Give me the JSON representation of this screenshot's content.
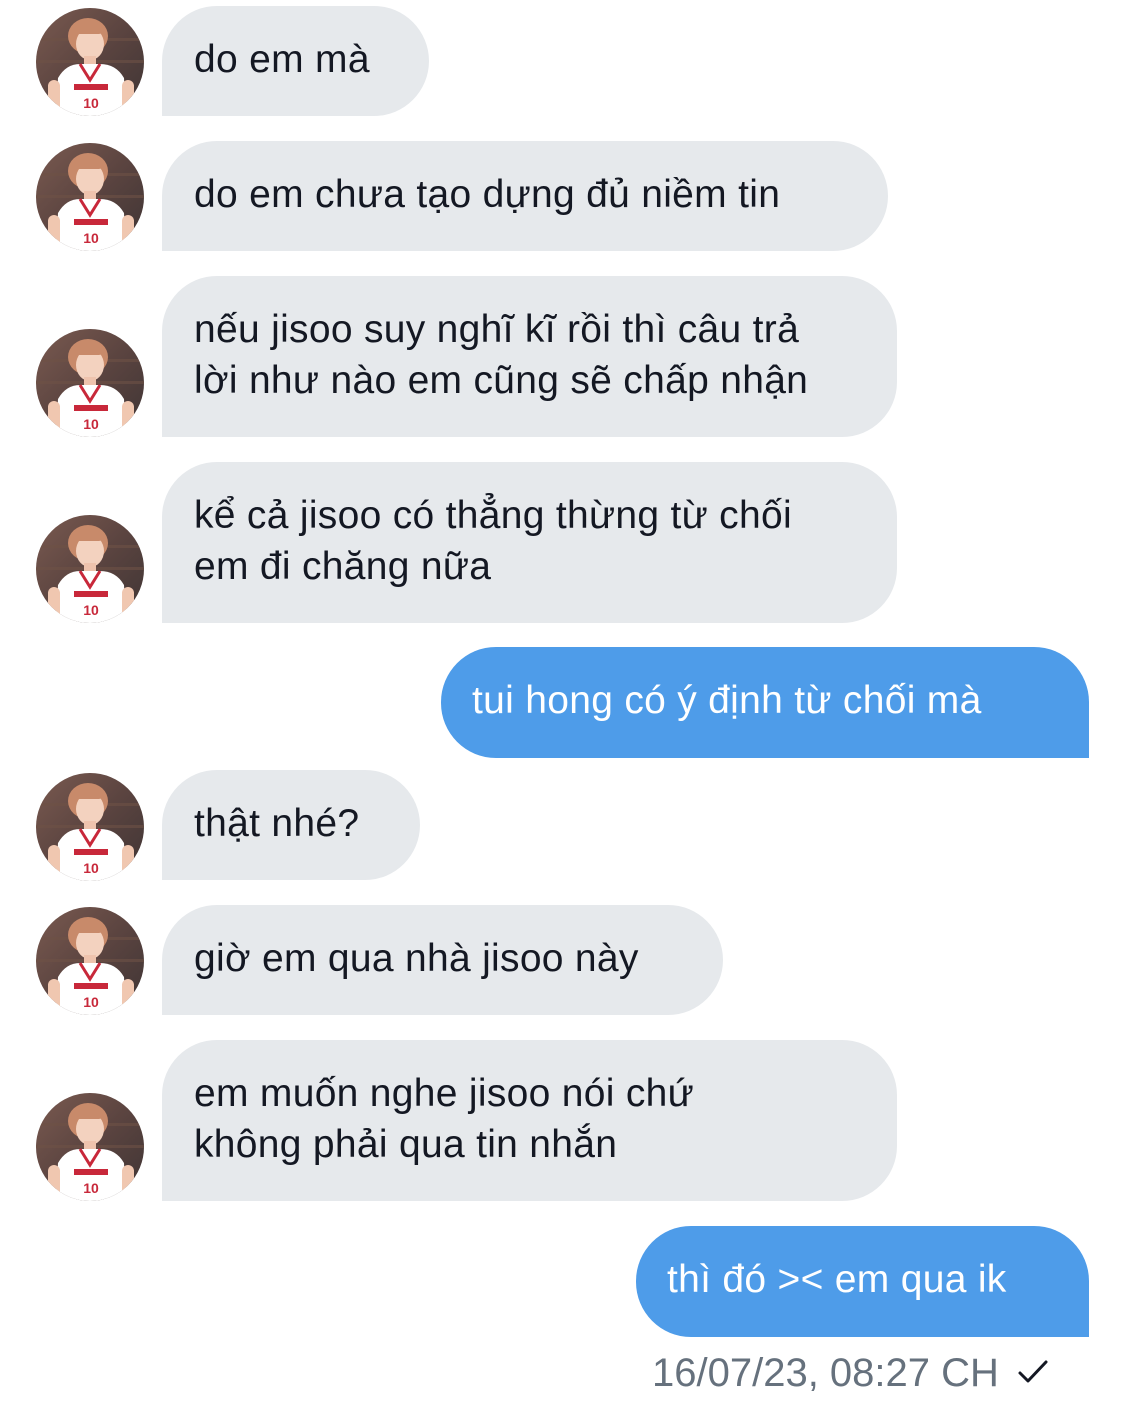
{
  "conversation": {
    "messages": [
      {
        "direction": "in",
        "lines": [
          "do em mà"
        ]
      },
      {
        "direction": "in",
        "lines": [
          "do em chưa tạo dựng đủ niềm tin"
        ]
      },
      {
        "direction": "in",
        "lines": [
          "nếu jisoo suy nghĩ kĩ rồi thì câu trả",
          "lời như nào em cũng sẽ chấp nhận"
        ]
      },
      {
        "direction": "in",
        "lines": [
          "kể cả jisoo có thẳng thừng từ chối",
          "em đi chăng nữa"
        ]
      },
      {
        "direction": "out",
        "lines": [
          "tui hong có ý định từ chối mà"
        ]
      },
      {
        "direction": "in",
        "lines": [
          "thật nhé?"
        ]
      },
      {
        "direction": "in",
        "lines": [
          "giờ em qua nhà jisoo này"
        ]
      },
      {
        "direction": "in",
        "lines": [
          "em muốn nghe jisoo nói chứ",
          "không phải qua tin nhắn"
        ]
      },
      {
        "direction": "out",
        "lines": [
          "thì đó >< em qua ik"
        ]
      }
    ],
    "last_message_meta": {
      "timestamp": "16/07/23, 08:27 CH",
      "status_icon": "single-check-icon"
    }
  },
  "colors": {
    "incoming_bubble": "#e6e9ec",
    "outgoing_bubble": "#4e9ce9",
    "incoming_text": "#141823",
    "outgoing_text": "#ffffff",
    "meta_text": "#66717d"
  }
}
